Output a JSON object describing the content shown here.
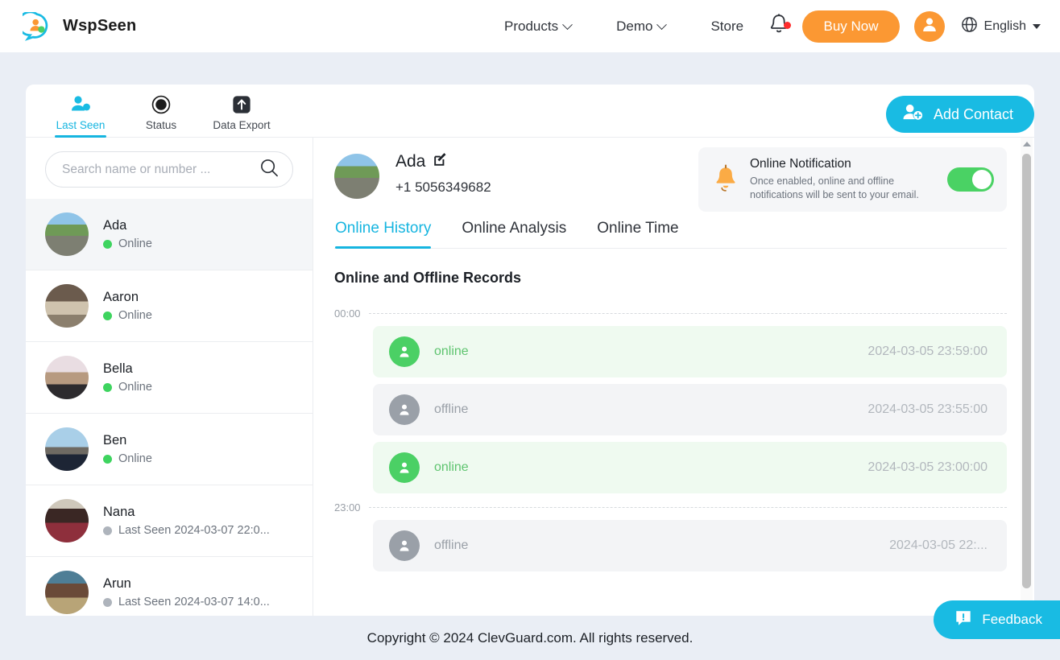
{
  "brand": {
    "name": "WspSeen",
    "logo_icon": "wspseen-logo-icon"
  },
  "topnav": {
    "items": [
      {
        "label": "Products",
        "has_caret": true
      },
      {
        "label": "Demo",
        "has_caret": true
      },
      {
        "label": "Store",
        "has_caret": false
      }
    ],
    "notification_icon": "bell-icon",
    "buy_now_label": "Buy Now",
    "account_icon": "user-avatar-icon",
    "globe_icon": "globe-icon",
    "language": "English"
  },
  "card": {
    "mode_tabs": [
      {
        "label": "Last Seen",
        "icon": "people-icon",
        "active": true
      },
      {
        "label": "Status",
        "icon": "status-ring-icon",
        "active": false
      },
      {
        "label": "Data Export",
        "icon": "upload-arrow-icon",
        "active": false
      }
    ],
    "add_contact_label": "Add Contact",
    "add_contact_icon": "add-person-icon"
  },
  "sidebar": {
    "search": {
      "placeholder": "Search name or number ...",
      "value": "",
      "icon": "search-icon"
    },
    "contacts": [
      {
        "name": "Ada",
        "status": "Online",
        "state": "online",
        "selected": true,
        "photo": "ph-ada"
      },
      {
        "name": "Aaron",
        "status": "Online",
        "state": "online",
        "selected": false,
        "photo": "ph-aaron"
      },
      {
        "name": "Bella",
        "status": "Online",
        "state": "online",
        "selected": false,
        "photo": "ph-bella"
      },
      {
        "name": "Ben",
        "status": "Online",
        "state": "online",
        "selected": false,
        "photo": "ph-ben"
      },
      {
        "name": "Nana",
        "status": "Last Seen 2024-03-07 22:0...",
        "state": "away",
        "selected": false,
        "photo": "ph-nana"
      },
      {
        "name": "Arun",
        "status": "Last Seen 2024-03-07 14:0...",
        "state": "away",
        "selected": false,
        "photo": "ph-arun"
      }
    ]
  },
  "detail": {
    "profile": {
      "name": "Ada",
      "phone": "+1 5056349682",
      "edit_icon": "edit-pencil-icon",
      "photo": "ph-ada"
    },
    "notification": {
      "icon": "bell-orange-icon",
      "title": "Online Notification",
      "description": "Once enabled, online and offline notifications will be sent to your email.",
      "toggle_on": true
    },
    "sub_tabs": [
      {
        "label": "Online History",
        "active": true
      },
      {
        "label": "Online Analysis",
        "active": false
      },
      {
        "label": "Online Time",
        "active": false
      }
    ],
    "records_title": "Online and Offline Records",
    "timeline": [
      {
        "kind": "time-mark",
        "label": "00:00"
      },
      {
        "kind": "record",
        "state": "online",
        "label": "online",
        "time": "2024-03-05 23:59:00"
      },
      {
        "kind": "record",
        "state": "offline",
        "label": "offline",
        "time": "2024-03-05 23:55:00"
      },
      {
        "kind": "record",
        "state": "online",
        "label": "online",
        "time": "2024-03-05 23:00:00"
      },
      {
        "kind": "time-mark",
        "label": "23:00"
      },
      {
        "kind": "record",
        "state": "offline",
        "label": "offline",
        "time": "2024-03-05 22:..."
      }
    ]
  },
  "footer": {
    "copyright": "Copyright © 2024 ClevGuard.com. All rights reserved.",
    "feedback_label": "Feedback",
    "feedback_icon": "feedback-alert-icon"
  },
  "colors": {
    "brand_cyan": "#19bbe3",
    "accent_orange": "#fb9833",
    "online_green": "#4bd065",
    "page_bg": "#eaeef5"
  }
}
